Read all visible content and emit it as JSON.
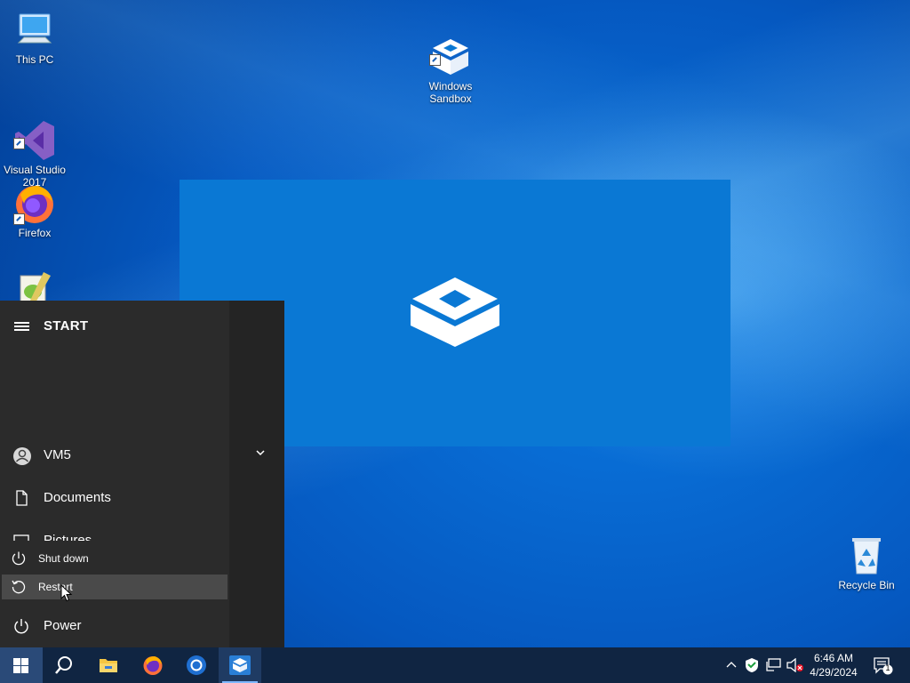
{
  "desktop": {
    "icons": [
      {
        "label": "This PC"
      },
      {
        "label": "Windows\nSandbox"
      },
      {
        "label": "Visual Studio\n2017"
      },
      {
        "label": "Firefox"
      },
      {
        "label": "Recycle Bin"
      }
    ]
  },
  "start_menu": {
    "title": "START",
    "user": "VM5",
    "items": [
      {
        "label": "Documents"
      },
      {
        "label": "Pictures"
      }
    ],
    "power_label": "Power",
    "power_menu": [
      {
        "label": "Shut down"
      },
      {
        "label": "Restart"
      }
    ]
  },
  "taskbar": {
    "time": "6:46 AM",
    "date": "4/29/2024",
    "notifications_count": "1",
    "pinned": [
      "search-icon",
      "file-explorer-icon",
      "firefox-icon",
      "chrome-icon",
      "windows-sandbox-icon"
    ]
  },
  "colors": {
    "accent": "#0a78d4",
    "start_bg": "#2b2b2b",
    "taskbar_bg": "#102542"
  }
}
